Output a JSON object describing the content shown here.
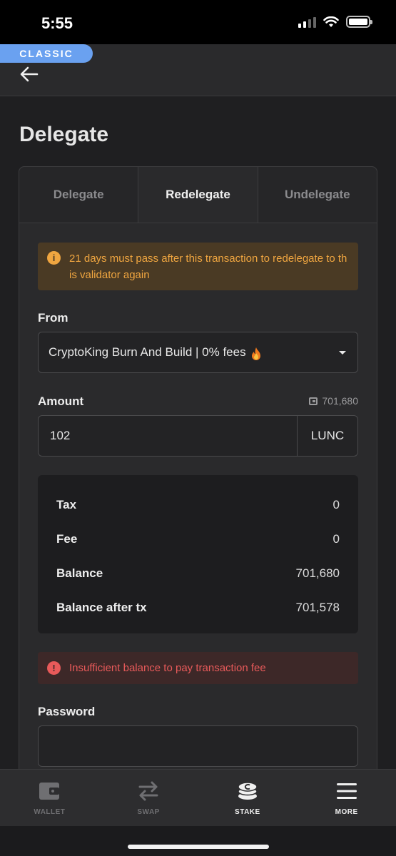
{
  "status_bar": {
    "time": "5:55"
  },
  "header": {
    "badge": "CLASSIC"
  },
  "page": {
    "title": "Delegate"
  },
  "tabs": [
    {
      "label": "Delegate",
      "active": false
    },
    {
      "label": "Redelegate",
      "active": true
    },
    {
      "label": "Undelegate",
      "active": false
    }
  ],
  "warning": {
    "text": "21 days must pass after this transaction to redelegate to this validator again"
  },
  "from": {
    "label": "From",
    "selected": "CryptoKing Burn And Build | 0% fees"
  },
  "amount": {
    "label": "Amount",
    "available": "701,680",
    "value": "102",
    "unit": "LUNC"
  },
  "summary": [
    {
      "key": "Tax",
      "value": "0"
    },
    {
      "key": "Fee",
      "value": "0"
    },
    {
      "key": "Balance",
      "value": "701,680"
    },
    {
      "key": "Balance after tx",
      "value": "701,578"
    }
  ],
  "error": {
    "text": "Insufficient balance to pay transaction fee"
  },
  "password": {
    "label": "Password",
    "value": ""
  },
  "bottom_nav": [
    {
      "label": "WALLET",
      "icon": "wallet-icon",
      "active": false
    },
    {
      "label": "SWAP",
      "icon": "swap-icon",
      "active": false
    },
    {
      "label": "STAKE",
      "icon": "stake-icon",
      "active": true
    },
    {
      "label": "MORE",
      "icon": "menu-icon",
      "active": false
    }
  ],
  "colors": {
    "accent": "#6aa1f0",
    "warning": "#f0a640",
    "error": "#e85a5a",
    "background": "#1f1f21"
  }
}
